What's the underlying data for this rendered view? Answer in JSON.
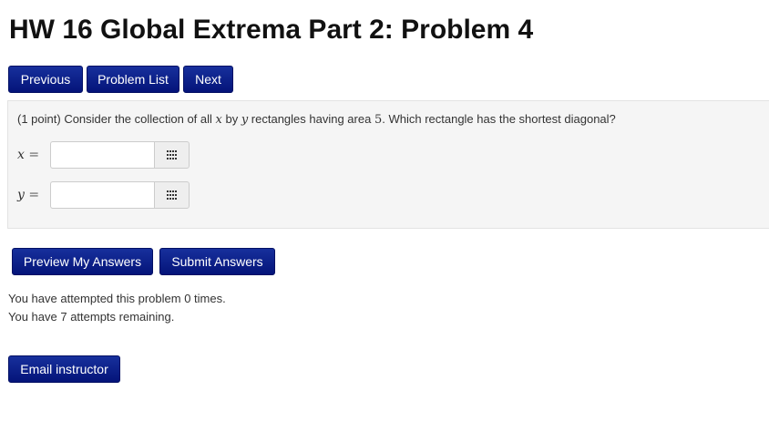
{
  "page": {
    "title": "HW 16 Global Extrema Part 2: Problem 4"
  },
  "nav": {
    "previous_label": "Previous",
    "problem_list_label": "Problem List",
    "next_label": "Next"
  },
  "problem": {
    "points": "(1 point)",
    "text_before_x": " Consider the collection of all ",
    "var_x": "x",
    "text_by": " by ",
    "var_y": "y",
    "text_before_area": " rectangles having area ",
    "area_value": "5",
    "text_end": ". Which rectangle has the shortest diagonal?",
    "answers": [
      {
        "var": "x",
        "equals": "=",
        "value": ""
      },
      {
        "var": "y",
        "equals": "=",
        "value": ""
      }
    ],
    "palette_icon": "grid-icon"
  },
  "actions": {
    "preview_label": "Preview My Answers",
    "submit_label": "Submit Answers"
  },
  "attempts": {
    "line1": "You have attempted this problem 0 times.",
    "line2": "You have 7 attempts remaining."
  },
  "footer": {
    "email_label": "Email instructor"
  },
  "colors": {
    "button_bg": "#0a1f8a",
    "problem_bg": "#f5f5f5"
  }
}
